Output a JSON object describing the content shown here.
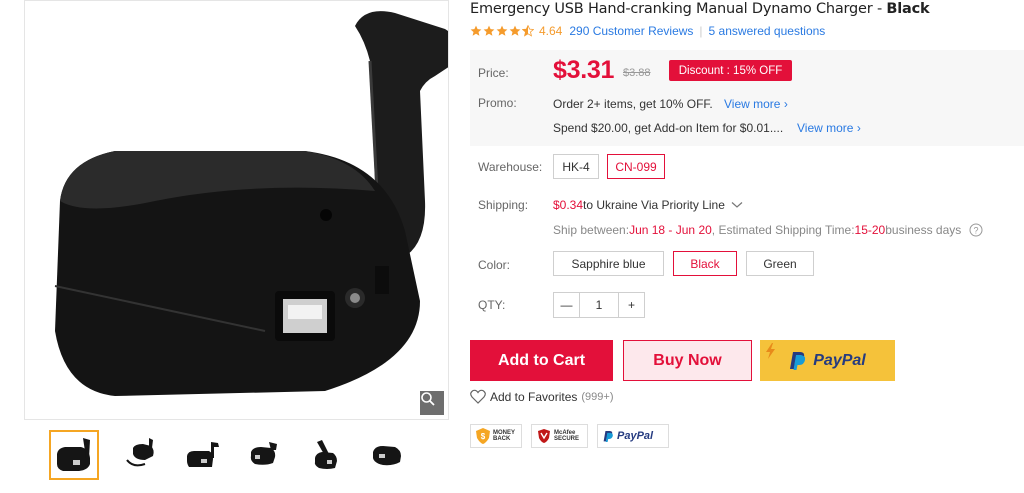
{
  "product": {
    "title": "Emergency USB Hand-cranking Manual Dynamo Charger - ",
    "variant": "Black",
    "rating": "4.64",
    "reviews_link": "290 Customer Reviews",
    "questions_link": "5 answered questions"
  },
  "price": {
    "label": "Price:",
    "current": "$3.31",
    "original": "$3.88",
    "discount": "Discount : 15% OFF"
  },
  "promo": {
    "label": "Promo:",
    "line1": "Order 2+ items, get 10% OFF.",
    "line2": "Spend $20.00, get Add-on Item for $0.01....",
    "view_more": "View more"
  },
  "warehouse": {
    "label": "Warehouse:",
    "options": [
      "HK-4",
      "CN-099"
    ],
    "selected": "CN-099"
  },
  "shipping": {
    "label": "Shipping:",
    "cost": "$0.34",
    "method": " to Ukraine Via Priority Line",
    "ship_between_label": "Ship between: ",
    "ship_between": "Jun 18 - Jun 20",
    "est_label": ", Estimated Shipping Time: ",
    "est_time": "15-20",
    "est_unit": " business days"
  },
  "color": {
    "label": "Color:",
    "options": [
      "Sapphire blue",
      "Black",
      "Green"
    ],
    "selected": "Black"
  },
  "qty": {
    "label": "QTY:",
    "value": "1",
    "minus": "—",
    "plus": "+"
  },
  "actions": {
    "add_to_cart": "Add to Cart",
    "buy_now": "Buy Now",
    "paypal": "PayPal",
    "favorites": "Add to Favorites",
    "favorites_count": "(999+)"
  },
  "badges": {
    "money_back": [
      "MONEY",
      "BACK"
    ],
    "mcafee": [
      "McAfee",
      "SECURE"
    ],
    "paypal": "PayPal"
  },
  "colors": {
    "accent": "#e3103a",
    "link": "#2a7ae2",
    "star": "#f59b2c",
    "paypal_yellow": "#f5c23a",
    "paypal_blue": "#253b80"
  }
}
